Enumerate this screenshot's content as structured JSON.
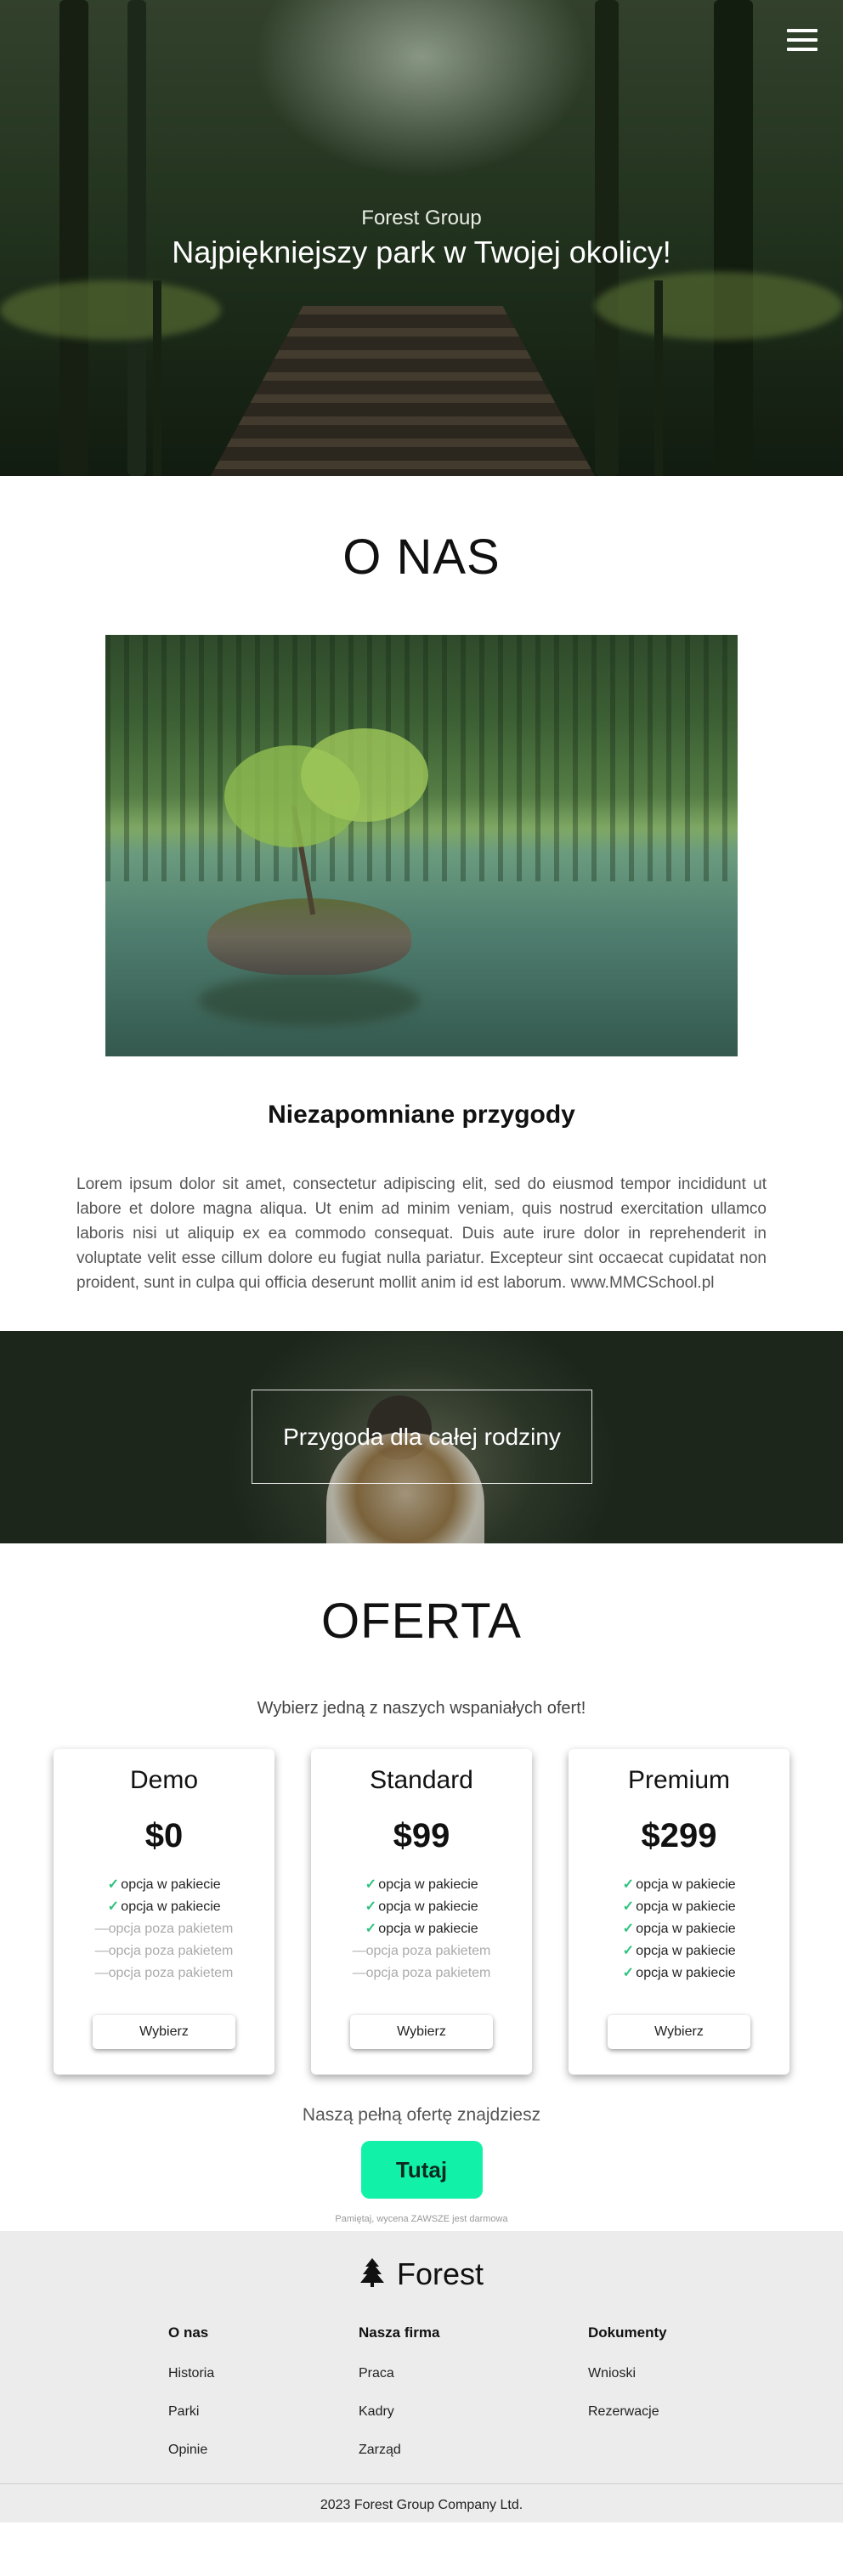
{
  "hero": {
    "brand": "Forest Group",
    "tagline": "Najpiękniejszy park w Twojej okolicy!"
  },
  "about": {
    "title": "O NAS",
    "subtitle": "Niezapomniane przygody",
    "text": "Lorem ipsum dolor sit amet, consectetur adipiscing elit, sed do eiusmod tempor incididunt ut labore et dolore magna aliqua. Ut enim ad minim veniam, quis nostrud exercitation ullamco laboris nisi ut aliquip ex ea commodo consequat. Duis aute irure dolor in reprehenderit in voluptate velit esse cillum dolore eu fugiat nulla pariatur. Excepteur sint occaecat cupidatat non proident, sunt in culpa qui officia deserunt mollit anim id est laborum. www.MMCSchool.pl"
  },
  "banner": {
    "button": "Przygoda dla całej rodziny"
  },
  "offer": {
    "title": "OFERTA",
    "lead": "Wybierz jedną z naszych wspaniałych ofert!",
    "plans": [
      {
        "name": "Demo",
        "price": "$0",
        "features": [
          {
            "text": "opcja w pakiecie",
            "included": true
          },
          {
            "text": "opcja w pakiecie",
            "included": true
          },
          {
            "text": "opcja poza pakietem",
            "included": false
          },
          {
            "text": "opcja poza pakietem",
            "included": false
          },
          {
            "text": "opcja poza pakietem",
            "included": false
          }
        ],
        "button": "Wybierz"
      },
      {
        "name": "Standard",
        "price": "$99",
        "features": [
          {
            "text": "opcja w pakiecie",
            "included": true
          },
          {
            "text": "opcja w pakiecie",
            "included": true
          },
          {
            "text": "opcja w pakiecie",
            "included": true
          },
          {
            "text": "opcja poza pakietem",
            "included": false
          },
          {
            "text": "opcja poza pakietem",
            "included": false
          }
        ],
        "button": "Wybierz"
      },
      {
        "name": "Premium",
        "price": "$299",
        "features": [
          {
            "text": "opcja w pakiecie",
            "included": true
          },
          {
            "text": "opcja w pakiecie",
            "included": true
          },
          {
            "text": "opcja w pakiecie",
            "included": true
          },
          {
            "text": "opcja w pakiecie",
            "included": true
          },
          {
            "text": "opcja w pakiecie",
            "included": true
          }
        ],
        "button": "Wybierz"
      }
    ],
    "full_offer": "Naszą pełną ofertę znajdziesz",
    "here_button": "Tutaj",
    "note": "Pamiętaj, wycena ZAWSZE jest darmowa"
  },
  "footer": {
    "logo": "Forest",
    "columns": [
      {
        "title": "O nas",
        "links": [
          "Historia",
          "Parki",
          "Opinie"
        ]
      },
      {
        "title": "Nasza firma",
        "links": [
          "Praca",
          "Kadry",
          "Zarząd"
        ]
      },
      {
        "title": "Dokumenty",
        "links": [
          "Wnioski",
          "Rezerwacje"
        ]
      }
    ],
    "copyright": "2023 Forest Group Company Ltd."
  },
  "icons": {
    "menu": "hamburger-menu-icon",
    "included": "check-icon",
    "excluded": "dash-icon",
    "logo": "tree-icon"
  },
  "colors": {
    "accent": "#11f2a8",
    "check": "#2ec27e",
    "footer_bg": "#ececec"
  }
}
